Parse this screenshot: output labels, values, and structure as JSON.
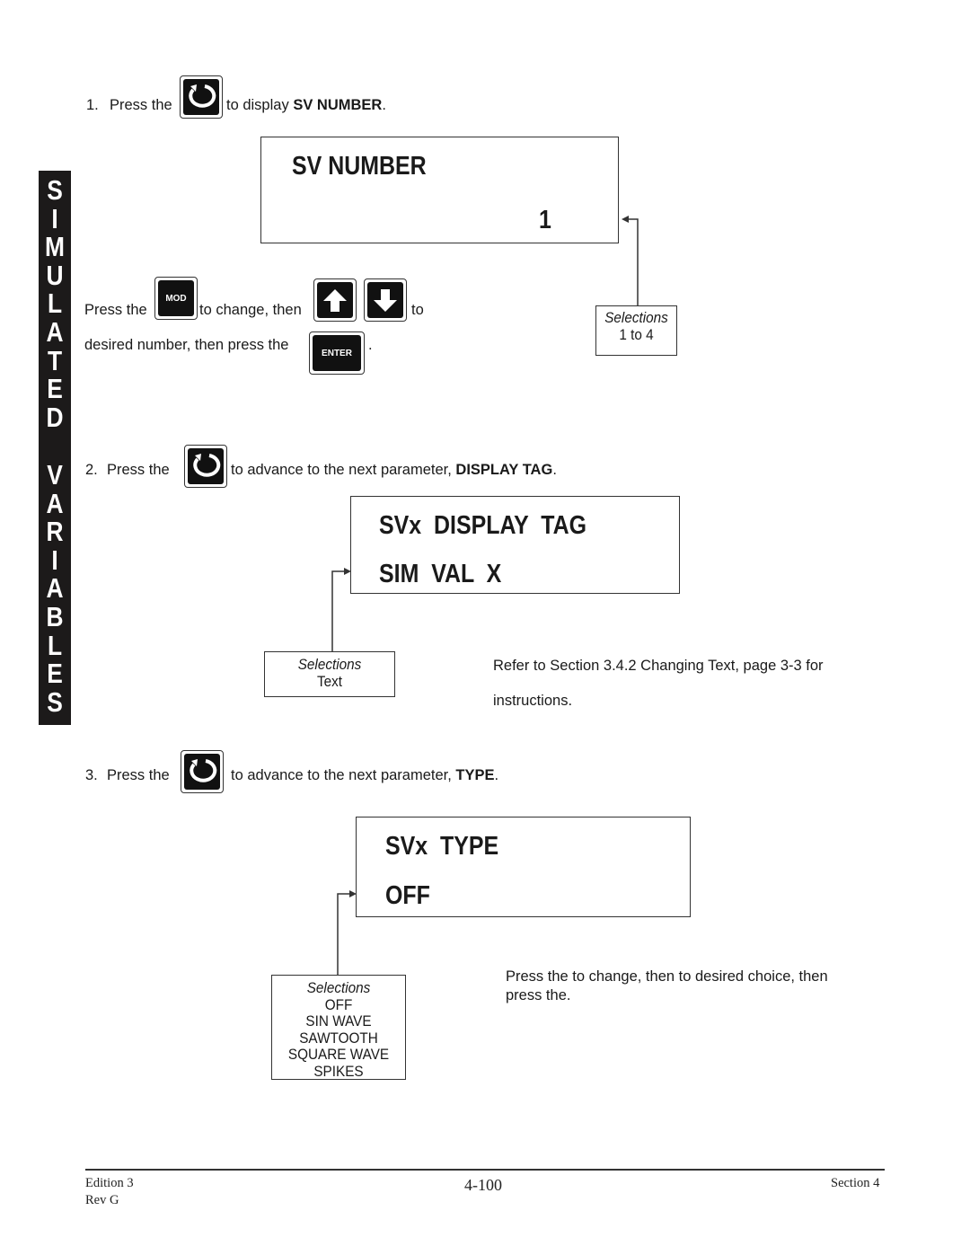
{
  "side_tab": {
    "word1": [
      "S",
      "I",
      "M",
      "U",
      "L",
      "A",
      "T",
      "E",
      "D"
    ],
    "word2": [
      "V",
      "A",
      "R",
      "I",
      "A",
      "B",
      "L",
      "E",
      "S"
    ]
  },
  "step1": {
    "number": "1.",
    "press_the": "Press the",
    "key_icon": "scroll-cycle-icon",
    "after_key": "to display",
    "param": "SV NUMBER",
    "period": ".",
    "display": {
      "line1": "SV NUMBER",
      "value": "1"
    },
    "selections": {
      "header": "Selections",
      "items": [
        "1 to 4"
      ]
    },
    "instructions": {
      "press_the": "Press the",
      "mod_key": "MOD",
      "to_change_then": "to change, then",
      "up_key_icon": "arrow-up-icon",
      "down_key_icon": "arrow-down-icon",
      "to": "to",
      "desired_line": "desired number, then press the",
      "enter_key": "ENTER",
      "period": "."
    }
  },
  "step2": {
    "number": "2.",
    "press_the": "Press the",
    "key_icon": "scroll-cycle-icon",
    "after_key": "to advance to the next parameter,",
    "param": "DISPLAY TAG",
    "period": ".",
    "display": {
      "line1": "SVx  DISPLAY  TAG",
      "line2": "SIM  VAL  X"
    },
    "selections": {
      "header": "Selections",
      "items": [
        "Text"
      ]
    },
    "note_line1": "Refer to Section 3.4.2 Changing Text, page 3-3 for",
    "note_line2": "instructions."
  },
  "step3": {
    "number": "3.",
    "press_the": "Press the",
    "key_icon": "scroll-cycle-icon",
    "after_key": "to advance to the next parameter,",
    "param": "TYPE",
    "period": ".",
    "display": {
      "line1": "SVx  TYPE",
      "line2": "OFF"
    },
    "selections": {
      "header": "Selections",
      "items": [
        "OFF",
        "SIN WAVE",
        "SAWTOOTH",
        "SQUARE WAVE",
        "SPIKES"
      ]
    },
    "note_line1": "Press the to change, then to desired choice, then",
    "note_line2": "press the."
  },
  "footer": {
    "edition": "Edition 3",
    "revision": "Rev G",
    "page": "4-100",
    "section": "Section 4"
  }
}
